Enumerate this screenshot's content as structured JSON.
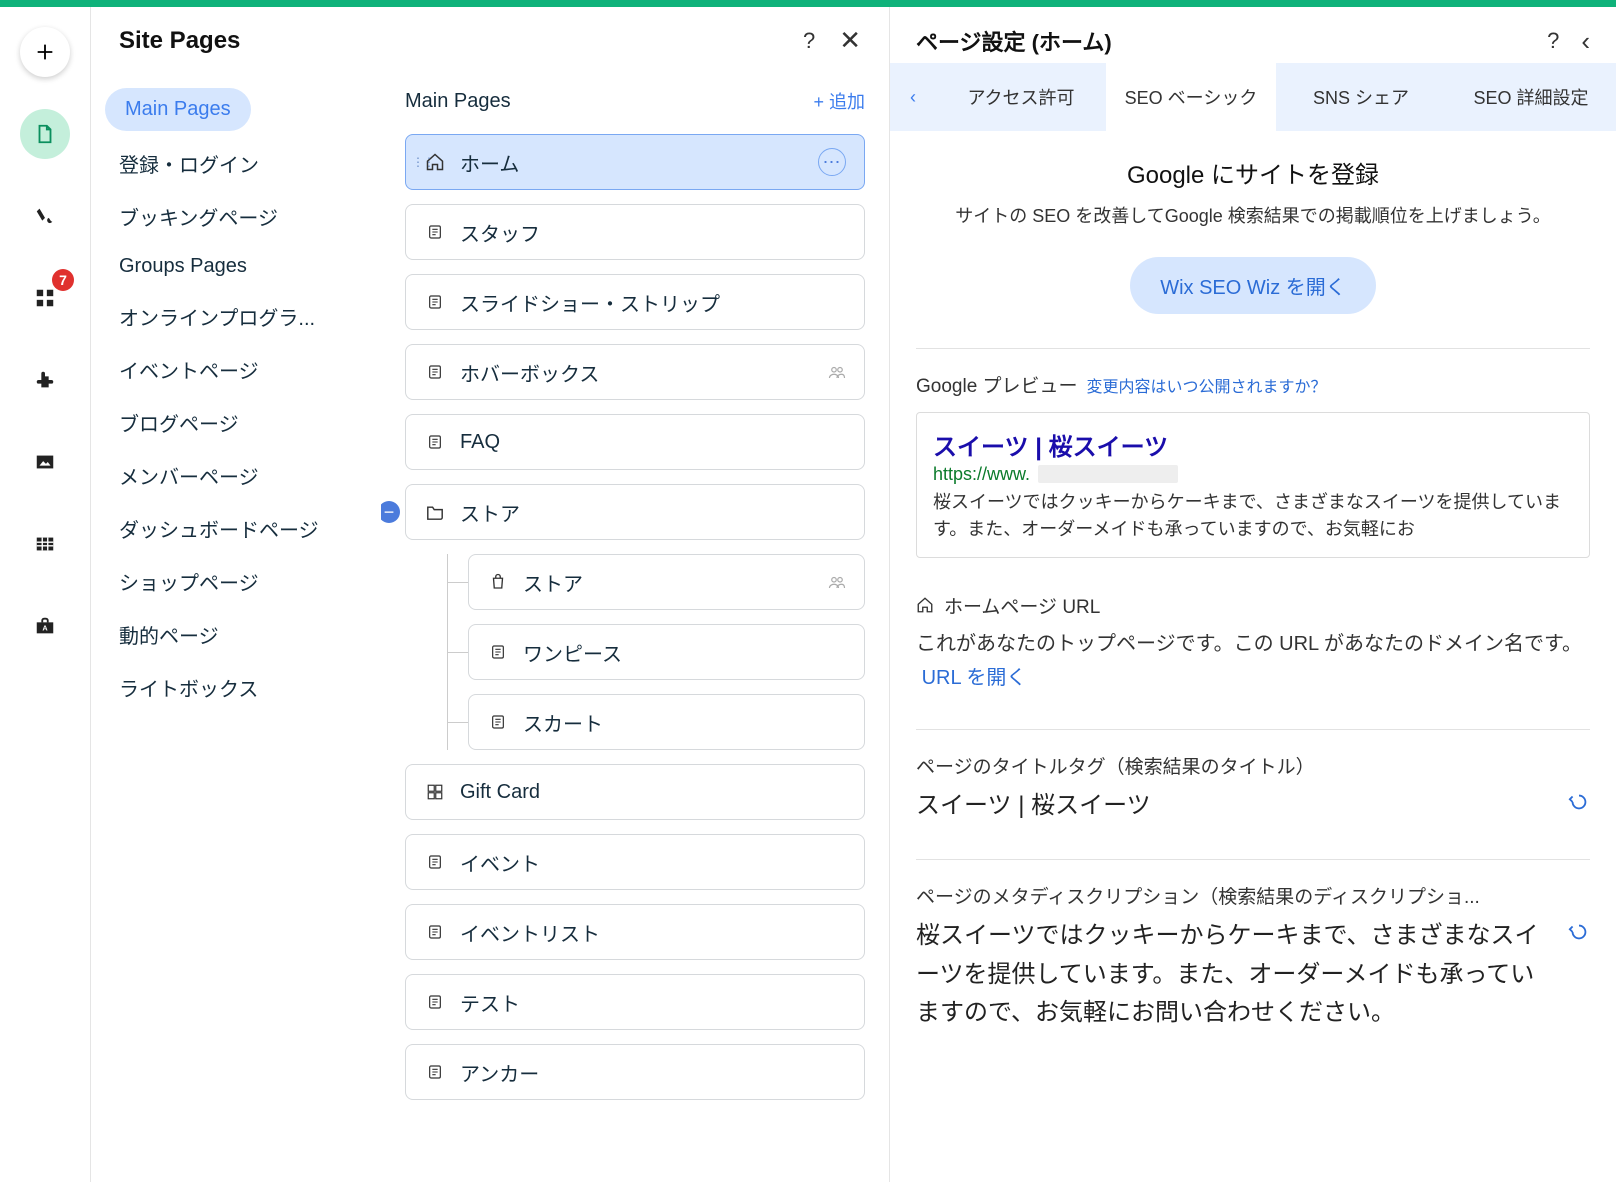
{
  "rail": {
    "badge_count": "7"
  },
  "pagesPanel": {
    "title": "Site Pages",
    "categories": [
      "Main Pages",
      "登録・ログイン",
      "ブッキングページ",
      "Groups Pages",
      "オンラインプログラ...",
      "イベントページ",
      "ブログページ",
      "メンバーページ",
      "ダッシュボードページ",
      "ショップページ",
      "動的ページ",
      "ライトボックス"
    ],
    "list_header": "Main Pages",
    "add_label": "+ 追加",
    "items": {
      "home": "ホーム",
      "staff": "スタッフ",
      "slideshow": "スライドショー・ストリップ",
      "hover": "ホバーボックス",
      "faq": "FAQ",
      "store_folder": "ストア",
      "store": "ストア",
      "onepiece": "ワンピース",
      "skirt": "スカート",
      "giftcard": "Gift Card",
      "event": "イベント",
      "eventlist": "イベントリスト",
      "test": "テスト",
      "anchor": "アンカー"
    }
  },
  "settingsPanel": {
    "title": "ページ設定 (ホーム)",
    "tabs": [
      "アクセス許可",
      "SEO ベーシック",
      "SNS シェア",
      "SEO 詳細設定"
    ],
    "register_title": "Google にサイトを登録",
    "register_sub": "サイトの SEO を改善してGoogle 検索結果での掲載順位を上げましょう。",
    "wiz_btn": "Wix SEO Wiz を開く",
    "preview_label": "Google プレビュー",
    "preview_link": "変更内容はいつ公開されますか？",
    "preview": {
      "title": "スイーツ | 桜スイーツ",
      "url_prefix": "https://www.",
      "desc": "桜スイーツではクッキーからケーキまで、さまざまなスイーツを提供しています。また、オーダーメイドも承っていますので、お気軽にお"
    },
    "homepage_label": "ホームページ URL",
    "homepage_desc": "これがあなたのトップページです。この URL があなたのドメイン名です。",
    "homepage_link": "URL を開く",
    "titletag_label": "ページのタイトルタグ（検索結果のタイトル）",
    "titletag_value": "スイーツ | 桜スイーツ",
    "metadesc_label": "ページのメタディスクリプション（検索結果のディスクリプショ...",
    "metadesc_value": "桜スイーツではクッキーからケーキまで、さまざまなスイーツを提供しています。また、オーダーメイドも承っていますので、お気軽にお問い合わせください。"
  }
}
